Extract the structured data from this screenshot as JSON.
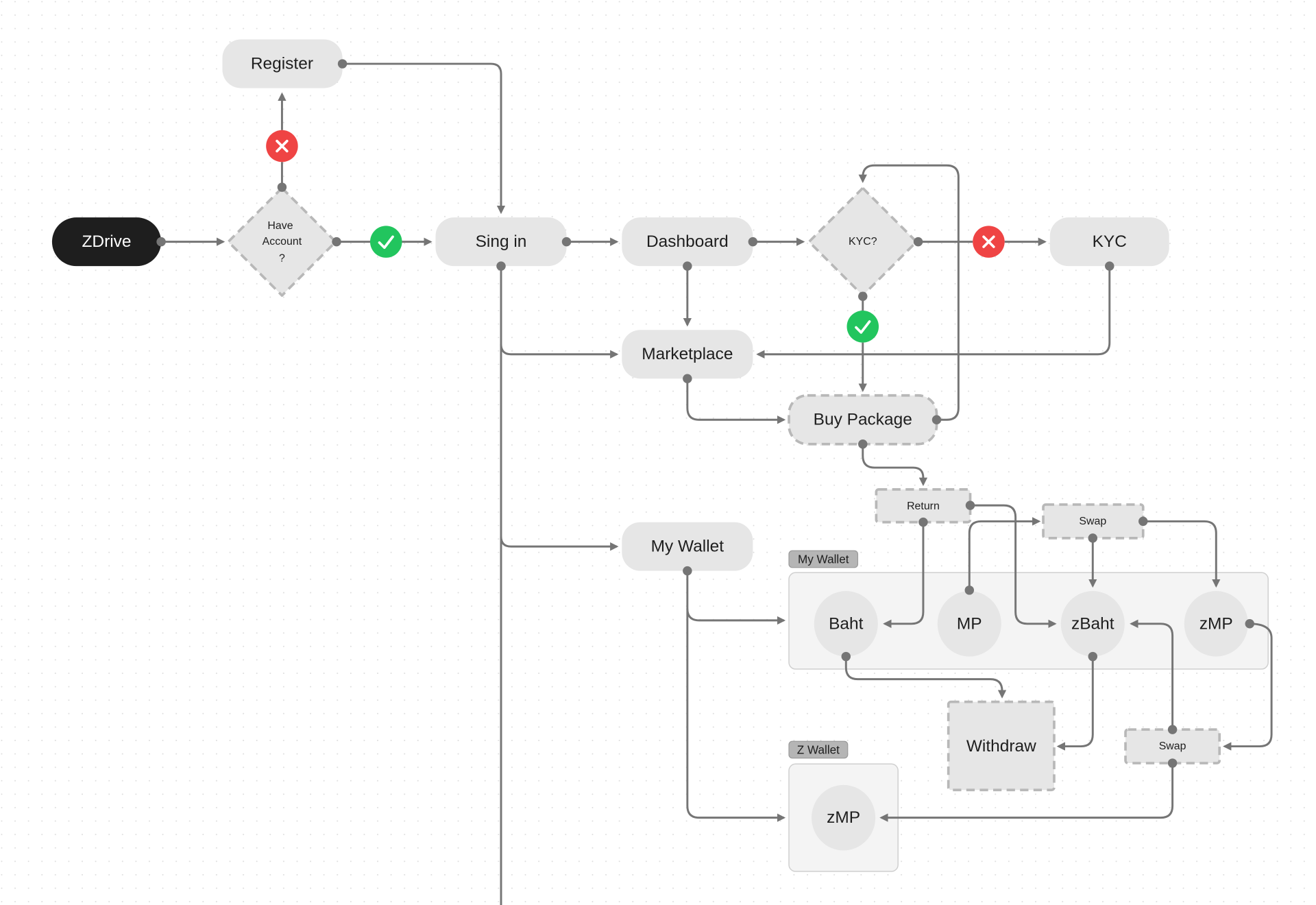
{
  "colors": {
    "start_node": "#1e1e1e",
    "node": "#e6e6e6",
    "edge": "#757575",
    "reject": "#ef4444",
    "accept": "#22c55e",
    "group": "#f4f4f4",
    "tag": "#b5b5b5"
  },
  "nodes": {
    "zdrive": "ZDrive",
    "have_account": [
      "Have",
      "Account",
      "?"
    ],
    "register": "Register",
    "sign_in": "Sing in",
    "dashboard": "Dashboard",
    "kyc_decision": "KYC?",
    "kyc": "KYC",
    "marketplace": "Marketplace",
    "buy_package": "Buy Package",
    "return": "Return",
    "swap_top": "Swap",
    "my_wallet": "My Wallet",
    "withdraw": "Withdraw",
    "swap_bottom": "Swap"
  },
  "groups": {
    "my_wallet": {
      "label": "My Wallet",
      "items": [
        "Baht",
        "MP",
        "zBaht",
        "zMP"
      ]
    },
    "z_wallet": {
      "label": "Z Wallet",
      "items": [
        "zMP"
      ]
    }
  },
  "icons": {
    "reject": "x-circle-icon",
    "accept": "check-circle-icon"
  }
}
